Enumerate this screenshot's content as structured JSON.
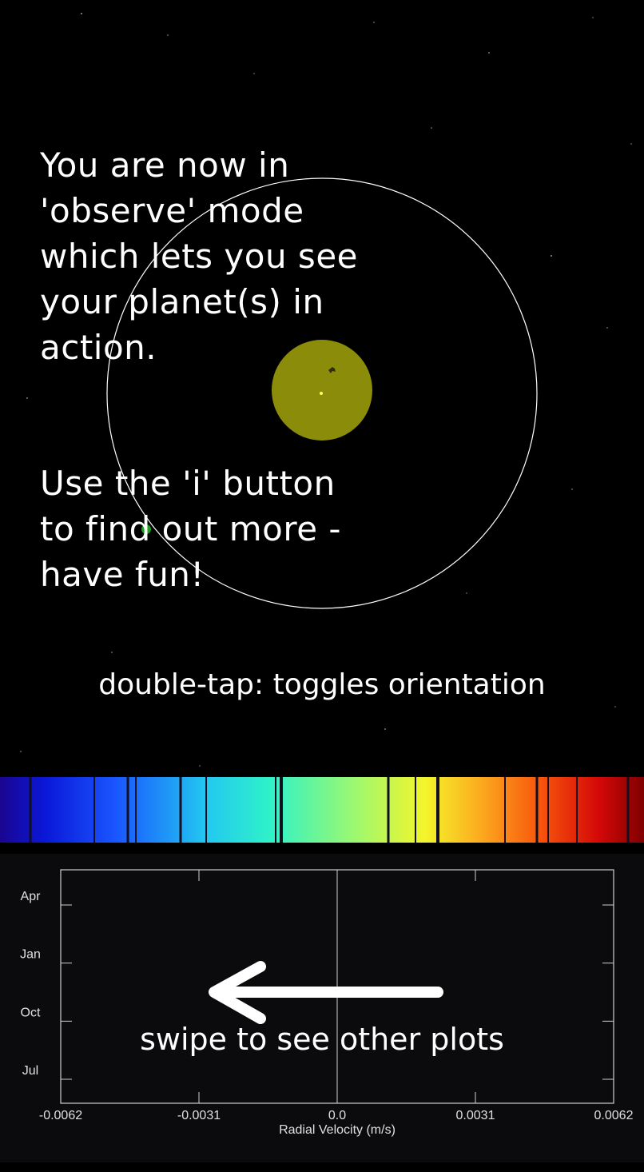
{
  "overlay": {
    "intro": "You are now in\n'observe' mode\nwhich lets you see\nyour planet(s) in\naction.",
    "help": "Use the 'i' button\nto find out more -\nhave fun!",
    "gesture_hint": "double-tap: toggles orientation",
    "swipe_hint": "swipe to see other plots"
  },
  "colors": {
    "background": "#000000",
    "star_fill": "#8c8c0b",
    "orbit_stroke": "#ffffff",
    "plot_background": "#0b0b0d",
    "axis_color": "#cfcfcf"
  },
  "icons": {
    "swipe_arrow": "left-arrow-icon"
  },
  "chart_data": {
    "type": "line",
    "xlabel": "Radial Velocity (m/s)",
    "x_ticks": [
      "-0.0062",
      "-0.0031",
      "0.0",
      "0.0031",
      "0.0062"
    ],
    "xlim": [
      -0.0062,
      0.0062
    ],
    "y_ticks": [
      "Apr",
      "Jan",
      "Oct",
      "Jul"
    ],
    "zero_line": 0.0,
    "grid": false
  }
}
